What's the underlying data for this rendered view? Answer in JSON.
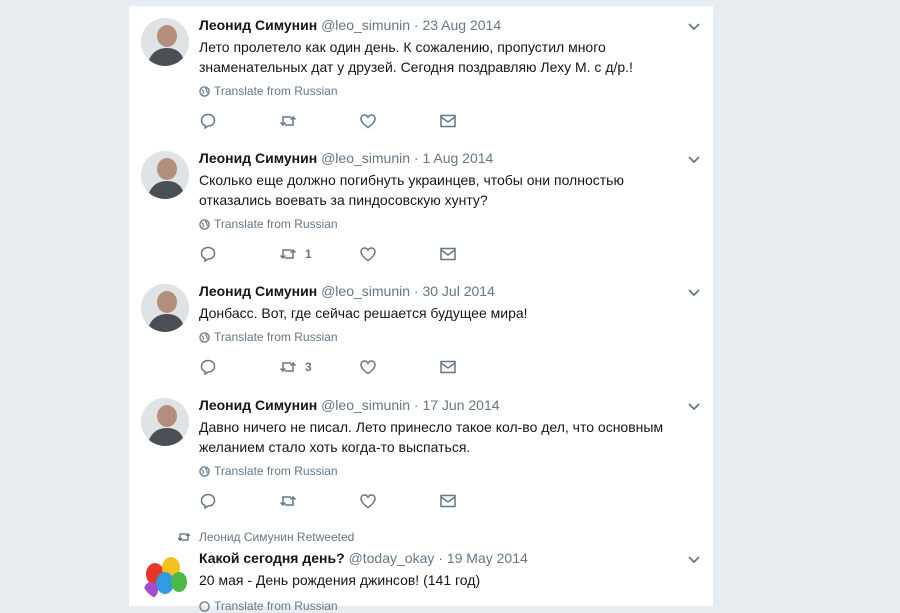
{
  "tweets": [
    {
      "name": "Леонид Симунин",
      "handle": "@leo_simunin",
      "date": "23 Aug 2014",
      "text": "Лето пролетело как один день. К сожалению, пропустил много знаменательных дат у друзей. Сегодня поздравляю Леху М. с д/р.!",
      "translate": "Translate from Russian",
      "retweets": ""
    },
    {
      "name": "Леонид Симунин",
      "handle": "@leo_simunin",
      "date": "1 Aug 2014",
      "text": "Сколько еще должно погибнуть украинцев, чтобы они полностью отказались воевать за пиндосовскую хунту?",
      "translate": "Translate from Russian",
      "retweets": "1"
    },
    {
      "name": "Леонид Симунин",
      "handle": "@leo_simunin",
      "date": "30 Jul 2014",
      "text": "Донбасс. Вот, где сейчас решается будущее мира!",
      "translate": "Translate from Russian",
      "retweets": "3"
    },
    {
      "name": "Леонид Симунин",
      "handle": "@leo_simunin",
      "date": "17 Jun 2014",
      "text": "Давно ничего не писал. Лето принесло такое кол-во дел, что основным желанием стало хоть когда-то выспаться.",
      "translate": "Translate from Russian",
      "retweets": ""
    }
  ],
  "retweet": {
    "label": "Леонид Симунин Retweeted",
    "name": "Какой сегодня день?",
    "handle": "@today_okay",
    "date": "19 May 2014",
    "text": "20 мая - День рождения джинсов! (141 год)",
    "translate": "Translate from Russian"
  },
  "separator": "·",
  "colors": {
    "text": "#14171a",
    "muted": "#657786",
    "background": "#e6ecf0"
  },
  "icons": [
    "reply-icon",
    "retweet-icon",
    "like-icon",
    "message-icon",
    "caret-down-icon",
    "globe-icon"
  ]
}
